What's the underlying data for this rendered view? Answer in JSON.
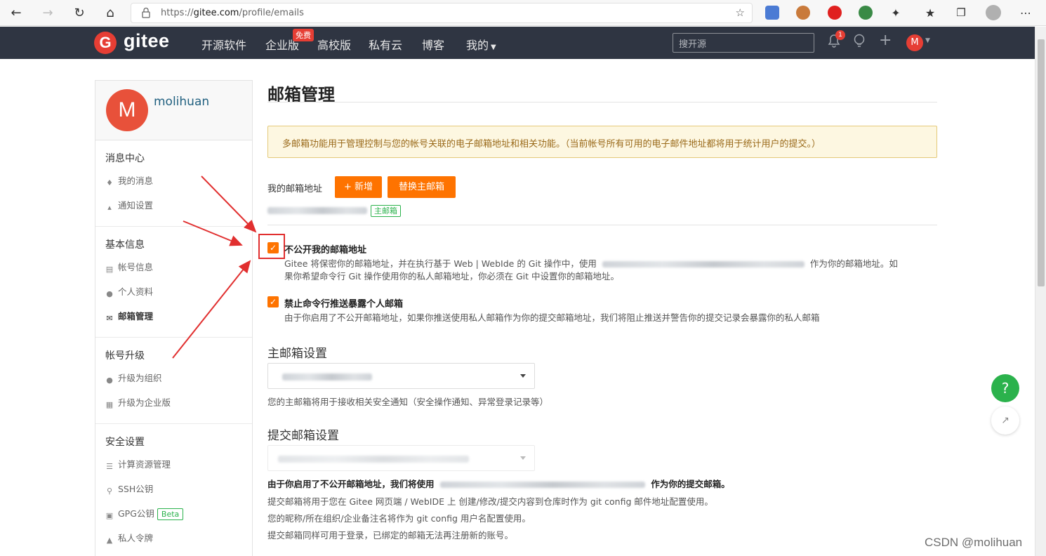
{
  "browser": {
    "url_prefix": "https://",
    "url_host": "gitee.com",
    "url_path": "/profile/emails"
  },
  "nav": {
    "logo": "gitee",
    "items": [
      "开源软件",
      "企业版",
      "高校版",
      "私有云",
      "博客",
      "我的"
    ],
    "free_badge": "免费",
    "search_placeholder": "搜开源",
    "notification_count": "1",
    "avatar_letter": "M"
  },
  "sidebar": {
    "avatar_letter": "M",
    "username": "molihuan",
    "sections": [
      {
        "title": "消息中心",
        "items": [
          {
            "label": "我的消息",
            "icon": "bell-icon"
          },
          {
            "label": "通知设置",
            "icon": "speaker-icon"
          }
        ]
      },
      {
        "title": "基本信息",
        "items": [
          {
            "label": "帐号信息",
            "icon": "id-card-icon"
          },
          {
            "label": "个人资料",
            "icon": "user-icon"
          },
          {
            "label": "邮箱管理",
            "icon": "envelope-icon"
          }
        ]
      },
      {
        "title": "帐号升级",
        "items": [
          {
            "label": "升级为组织",
            "icon": "users-icon"
          },
          {
            "label": "升级为企业版",
            "icon": "building-icon"
          }
        ]
      },
      {
        "title": "安全设置",
        "items": [
          {
            "label": "计算资源管理",
            "icon": "server-icon"
          },
          {
            "label": "SSH公钥",
            "icon": "key-icon"
          },
          {
            "label": "GPG公钥",
            "icon": "lock-icon",
            "badge": "Beta"
          },
          {
            "label": "私人令牌",
            "icon": "token-icon"
          }
        ]
      }
    ]
  },
  "main": {
    "title": "邮箱管理",
    "notice": "多邮箱功能用于管理控制与您的帐号关联的电子邮箱地址和相关功能。（当前帐号所有可用的电子邮件地址都将用于统计用户的提交。）",
    "my_email_label": "我的邮箱地址",
    "add_button": "+ 新增",
    "replace_button": "替换主邮箱",
    "primary_tag": "主邮箱",
    "option1_title": "不公开我的邮箱地址",
    "option1_desc_a": "Gitee 将保密你的邮箱地址，并在执行基于 Web | WebIde 的 Git 操作中，使用",
    "option1_desc_b": "作为你的邮箱地址。如",
    "option1_desc_c": "果你希望命令行 Git 操作使用你的私人邮箱地址，你必须在 Git 中设置你的邮箱地址。",
    "option2_title": "禁止命令行推送暴露个人邮箱",
    "option2_desc": "由于你启用了不公开邮箱地址，如果你推送使用私人邮箱作为你的提交邮箱地址，我们将阻止推送并警告你的提交记录会暴露你的私人邮箱",
    "primary_setting_title": "主邮箱设置",
    "primary_setting_help": "您的主邮箱将用于接收相关安全通知（安全操作通知、异常登录记录等）",
    "commit_setting_title": "提交邮箱设置",
    "commit_bold_a": "由于你启用了不公开邮箱地址，我们将使用",
    "commit_bold_b": "作为你的提交邮箱。",
    "commit_help1": "提交邮箱将用于您在 Gitee 网页端 / WebIDE 上 创建/修改/提交内容到仓库时作为 git config 邮件地址配置使用。",
    "commit_help2": "您的昵称/所在组织/企业备注名将作为 git config 用户名配置使用。",
    "commit_help3": "提交邮箱同样可用于登录，已绑定的邮箱无法再注册新的账号。"
  },
  "floating": {
    "help": "?"
  },
  "watermark": "CSDN @molihuan",
  "colors": {
    "accent": "#fe7300",
    "nav_bg": "#2f3542",
    "brand_red": "#e63e34",
    "success": "#2bb24c",
    "annotation_red": "#e12f2f"
  }
}
